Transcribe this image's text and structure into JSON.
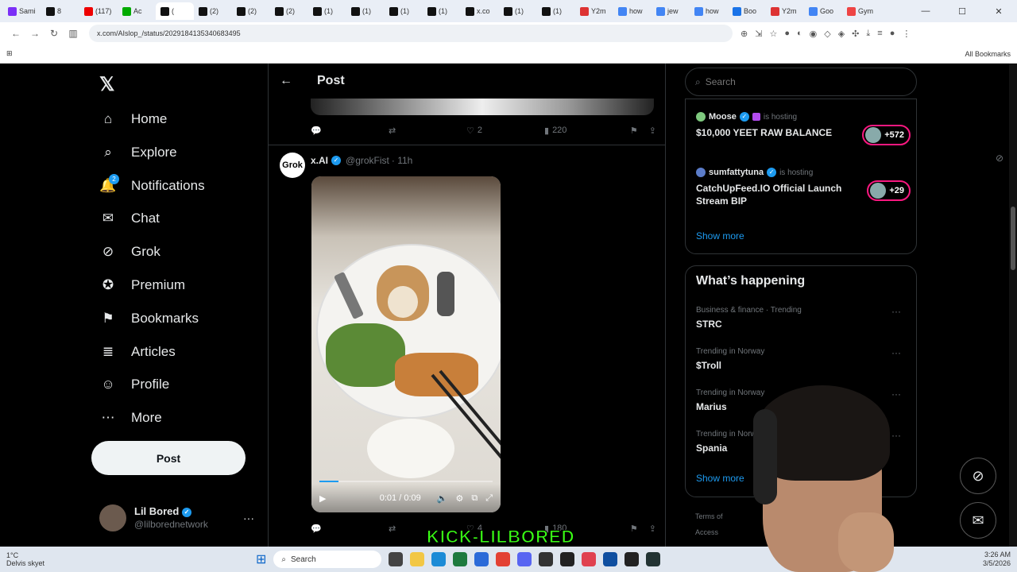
{
  "browser": {
    "tabs": [
      "Sami",
      "8",
      "(117)",
      "Ac",
      "(",
      "(2)",
      "(2)",
      "(2)",
      "(1)",
      "(1)",
      "(1)",
      "(1)",
      "x.co",
      "(1)",
      "(1)",
      "Y2m",
      "how",
      "jew",
      "how",
      "Boo",
      "Y2m",
      "Goo",
      "Gym"
    ],
    "url": "x.com/AIslop_/status/2029184135340683495",
    "all_bookmarks": "All Bookmarks"
  },
  "nav": {
    "logo": "𝕏",
    "items": [
      {
        "label": "Home",
        "icon": "⌂"
      },
      {
        "label": "Explore",
        "icon": "⌕"
      },
      {
        "label": "Notifications",
        "icon": "🔔",
        "badge": "2"
      },
      {
        "label": "Chat",
        "icon": "✉"
      },
      {
        "label": "Grok",
        "icon": "⊘"
      },
      {
        "label": "Premium",
        "icon": "✪"
      },
      {
        "label": "Bookmarks",
        "icon": "⚑"
      },
      {
        "label": "Articles",
        "icon": "≣"
      },
      {
        "label": "Profile",
        "icon": "☺"
      },
      {
        "label": "More",
        "icon": "⋯"
      }
    ],
    "post_button": "Post",
    "user": {
      "name": "Lil Bored",
      "handle": "@lilborednetwork"
    }
  },
  "timeline": {
    "header_title": "Post",
    "prev_actions": {
      "likes": "2",
      "views": "220"
    },
    "tweet": {
      "name": "x.AI",
      "handle": "@grokFist",
      "time": "· 11h",
      "avatar_text": "Grok",
      "video_time": "0:01 / 0:09",
      "progress": 0.11,
      "actions": {
        "likes": "4",
        "views": "180"
      }
    },
    "overlay_banner": "KICK-LILBORED"
  },
  "sidebar": {
    "search_placeholder": "Search",
    "spaces": [
      {
        "host": "Moose",
        "status": "is hosting",
        "title": "$10,000 YEET RAW BALANCE",
        "count": "+572"
      },
      {
        "host": "sumfattytuna",
        "status": "is hosting",
        "title": "CatchUpFeed.IO Official Launch Stream BIP",
        "count": "+29"
      }
    ],
    "show_more": "Show more",
    "happening_title": "What’s happening",
    "trends": [
      {
        "meta": "Business & finance · Trending",
        "name": "STRC"
      },
      {
        "meta": "Trending in Norway",
        "name": "$Troll"
      },
      {
        "meta": "Trending in Norway",
        "name": "Marius"
      },
      {
        "meta": "Trending in Norway",
        "name": "Spania"
      }
    ],
    "footer": "Terms of",
    "footer2": "Access"
  },
  "taskbar": {
    "weather_temp": "1°C",
    "weather_desc": "Delvis skyet",
    "search": "Search",
    "time": "3:26 AM",
    "date": "3/5/2026"
  },
  "colors": {
    "accent": "#1d9bf0",
    "live": "#f91880",
    "banner": "#39ff14"
  }
}
